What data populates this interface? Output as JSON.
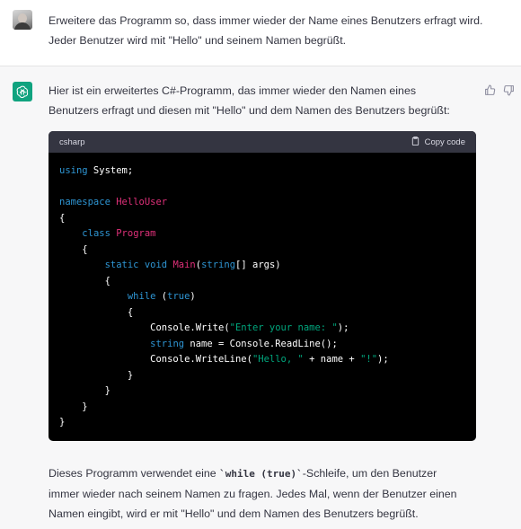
{
  "user_message": {
    "text": "Erweitere das Programm so, dass immer wieder der Name eines Benutzers erfragt wird. Jeder Benutzer wird mit \"Hello\" und seinem Namen begrüßt."
  },
  "assistant_message": {
    "intro": "Hier ist ein erweitertes C#-Programm, das immer wieder den Namen eines Benutzers erfragt und diesen mit \"Hello\" und dem Namen des Benutzers begrüßt:",
    "code_block": {
      "language": "csharp",
      "copy_label": "Copy code",
      "lines": [
        [
          {
            "t": "using",
            "c": "kw"
          },
          {
            "t": " System;",
            "c": "plain"
          }
        ],
        [],
        [
          {
            "t": "namespace",
            "c": "kw"
          },
          {
            "t": " ",
            "c": "plain"
          },
          {
            "t": "HelloUser",
            "c": "type"
          }
        ],
        [
          {
            "t": "{",
            "c": "plain"
          }
        ],
        [
          {
            "t": "    ",
            "c": "plain"
          },
          {
            "t": "class",
            "c": "kw"
          },
          {
            "t": " ",
            "c": "plain"
          },
          {
            "t": "Program",
            "c": "type"
          }
        ],
        [
          {
            "t": "    {",
            "c": "plain"
          }
        ],
        [
          {
            "t": "        ",
            "c": "plain"
          },
          {
            "t": "static",
            "c": "kw"
          },
          {
            "t": " ",
            "c": "plain"
          },
          {
            "t": "void",
            "c": "kw"
          },
          {
            "t": " ",
            "c": "plain"
          },
          {
            "t": "Main",
            "c": "type"
          },
          {
            "t": "(",
            "c": "plain"
          },
          {
            "t": "string",
            "c": "kw"
          },
          {
            "t": "[] args)",
            "c": "plain"
          }
        ],
        [
          {
            "t": "        {",
            "c": "plain"
          }
        ],
        [
          {
            "t": "            ",
            "c": "plain"
          },
          {
            "t": "while",
            "c": "kw"
          },
          {
            "t": " (",
            "c": "plain"
          },
          {
            "t": "true",
            "c": "kw"
          },
          {
            "t": ")",
            "c": "plain"
          }
        ],
        [
          {
            "t": "            {",
            "c": "plain"
          }
        ],
        [
          {
            "t": "                Console.Write(",
            "c": "plain"
          },
          {
            "t": "\"Enter your name: \"",
            "c": "str"
          },
          {
            "t": ");",
            "c": "plain"
          }
        ],
        [
          {
            "t": "                ",
            "c": "plain"
          },
          {
            "t": "string",
            "c": "kw"
          },
          {
            "t": " name = Console.ReadLine();",
            "c": "plain"
          }
        ],
        [
          {
            "t": "                Console.WriteLine(",
            "c": "plain"
          },
          {
            "t": "\"Hello, \"",
            "c": "str"
          },
          {
            "t": " + name + ",
            "c": "plain"
          },
          {
            "t": "\"!\"",
            "c": "str"
          },
          {
            "t": ");",
            "c": "plain"
          }
        ],
        [
          {
            "t": "            }",
            "c": "plain"
          }
        ],
        [
          {
            "t": "        }",
            "c": "plain"
          }
        ],
        [
          {
            "t": "    }",
            "c": "plain"
          }
        ],
        [
          {
            "t": "}",
            "c": "plain"
          }
        ]
      ]
    },
    "outro_before": "Dieses Programm verwendet eine ",
    "outro_code": "`while (true)`",
    "outro_after": "-Schleife, um den Benutzer immer wieder nach seinem Namen zu fragen. Jedes Mal, wenn der Benutzer einen Namen eingibt, wird er mit \"Hello\" und dem Namen des Benutzers begrüßt."
  },
  "icons": {
    "user_avatar": "user-photo-avatar",
    "assistant_avatar": "openai-logo-icon",
    "thumbs_up": "thumbs-up-icon",
    "thumbs_down": "thumbs-down-icon",
    "copy": "clipboard-icon"
  },
  "colors": {
    "accent": "#10a37f",
    "code_keyword": "#2e95d3",
    "code_type": "#df3079",
    "code_string": "#00a67d",
    "code_bg": "#000000",
    "code_header_bg": "#343541"
  }
}
